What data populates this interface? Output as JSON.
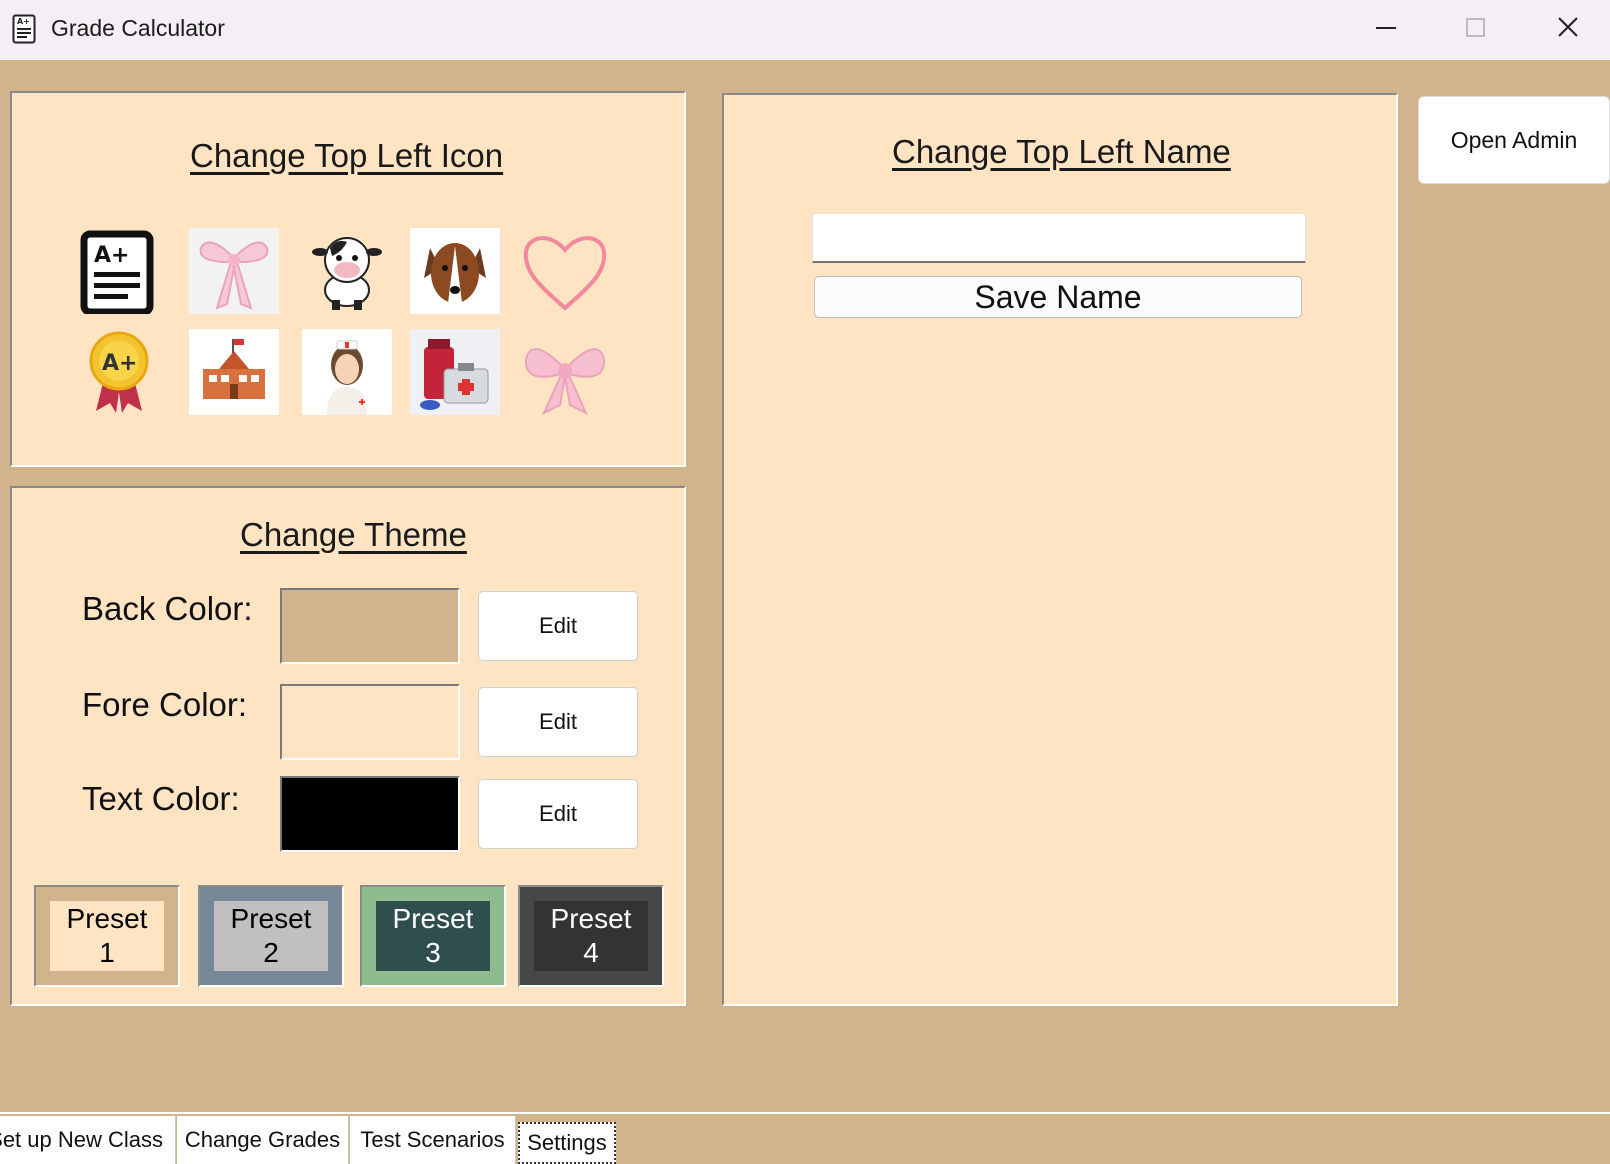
{
  "window": {
    "title": "Grade Calculator",
    "controls": [
      "minimize",
      "maximize",
      "close"
    ]
  },
  "icons_panel": {
    "heading": "Change Top Left Icon",
    "icons": [
      "report-card-icon",
      "pink-bow-icon",
      "cow-icon",
      "dog-icon",
      "heart-outline-icon",
      "award-ribbon-icon",
      "school-icon",
      "nurse-icon",
      "medicine-kit-icon",
      "pink-ribbon-icon"
    ]
  },
  "theme_panel": {
    "heading": "Change Theme",
    "rows": [
      {
        "label": "Back Color:",
        "color": "#d2b48c",
        "button": "Edit"
      },
      {
        "label": "Fore Color:",
        "color": "#ffe4c4",
        "button": "Edit"
      },
      {
        "label": "Text Color:",
        "color": "#000000",
        "button": "Edit"
      }
    ],
    "presets": [
      {
        "label_line1": "Preset",
        "label_line2": "1",
        "outer": "#d2b48c",
        "inner": "#ffe4c4",
        "text": "#000000"
      },
      {
        "label_line1": "Preset",
        "label_line2": "2",
        "outer": "#778899",
        "inner": "#c0c0c0",
        "text": "#000000"
      },
      {
        "label_line1": "Preset",
        "label_line2": "3",
        "outer": "#8fbc8f",
        "inner": "#2f4f4f",
        "text": "#ffffff"
      },
      {
        "label_line1": "Preset",
        "label_line2": "4",
        "outer": "#474747",
        "inner": "#333333",
        "text": "#ffffff"
      }
    ]
  },
  "name_panel": {
    "heading": "Change Top Left Name",
    "input_value": "",
    "save_button": "Save Name"
  },
  "admin_button": "Open Admin",
  "tabs": [
    {
      "label": "Set up New Class",
      "active": false
    },
    {
      "label": "Change Grades",
      "active": false
    },
    {
      "label": "Test Scenarios",
      "active": false
    },
    {
      "label": "Settings",
      "active": true
    }
  ]
}
